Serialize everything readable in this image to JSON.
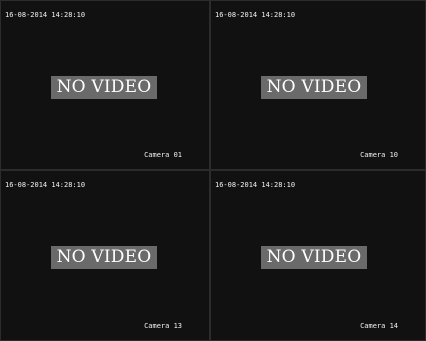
{
  "tiles": [
    {
      "timestamp": "16-08-2014 14:28:10",
      "status": "NO VIDEO",
      "camera": "Camera 01"
    },
    {
      "timestamp": "16-08-2014 14:28:10",
      "status": "NO VIDEO",
      "camera": "Camera 10"
    },
    {
      "timestamp": "16-08-2014 14:28:10",
      "status": "NO VIDEO",
      "camera": "Camera 13"
    },
    {
      "timestamp": "16-08-2014 14:28:10",
      "status": "NO VIDEO",
      "camera": "Camera 14"
    }
  ],
  "colors": {
    "background": "#111111",
    "placeholder": "#6a6a6a",
    "text": "#f2f2f2",
    "divider": "#2c2c2c"
  }
}
